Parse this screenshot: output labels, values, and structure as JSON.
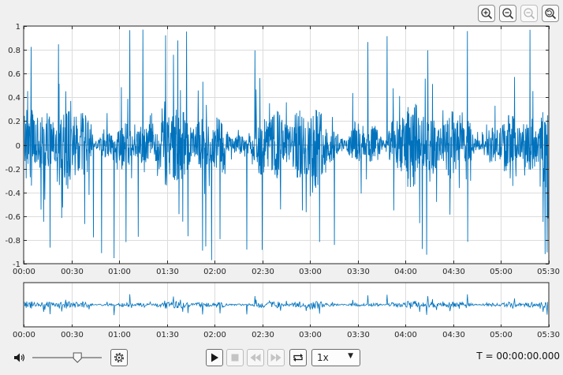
{
  "toolbar": {
    "buttons": [
      {
        "name": "zoom-in-button",
        "icon": "zoom-in-icon",
        "enabled": true
      },
      {
        "name": "zoom-out-button",
        "icon": "zoom-out-icon",
        "enabled": true
      },
      {
        "name": "pan-button",
        "icon": "pan-icon",
        "enabled": false
      },
      {
        "name": "restore-view-button",
        "icon": "restore-view-icon",
        "enabled": true
      }
    ]
  },
  "main_axes": {
    "y_ticks": [
      "1",
      "0.8",
      "0.6",
      "0.4",
      "0.2",
      "0",
      "-0.2",
      "-0.4",
      "-0.6",
      "-0.8",
      "-1"
    ],
    "x_ticks": [
      "00:00",
      "00:30",
      "01:00",
      "01:30",
      "02:00",
      "02:30",
      "03:00",
      "03:30",
      "04:00",
      "04:30",
      "05:00",
      "05:30"
    ]
  },
  "overview_axes": {
    "x_ticks": [
      "00:00",
      "00:30",
      "01:00",
      "01:30",
      "02:00",
      "02:30",
      "03:00",
      "03:30",
      "04:00",
      "04:30",
      "05:00",
      "05:30"
    ]
  },
  "chart_data": {
    "type": "line",
    "title": "",
    "xlabel": "",
    "ylabel": "",
    "xlim": [
      "00:00",
      "05:30"
    ],
    "ylim": [
      -1,
      1
    ],
    "grid": true,
    "series_color": "#0072bd",
    "description_values": "audio waveform amplitude, approx peaks between -0.9 and 0.98"
  },
  "controls": {
    "volume": {
      "level": 0.65
    },
    "speed": {
      "selected": "1x"
    },
    "time_readout": "T = 00:00:00.000"
  },
  "colors": {
    "wave": "#0072bd",
    "grid": "#dcdcdc",
    "axis": "#262626"
  }
}
